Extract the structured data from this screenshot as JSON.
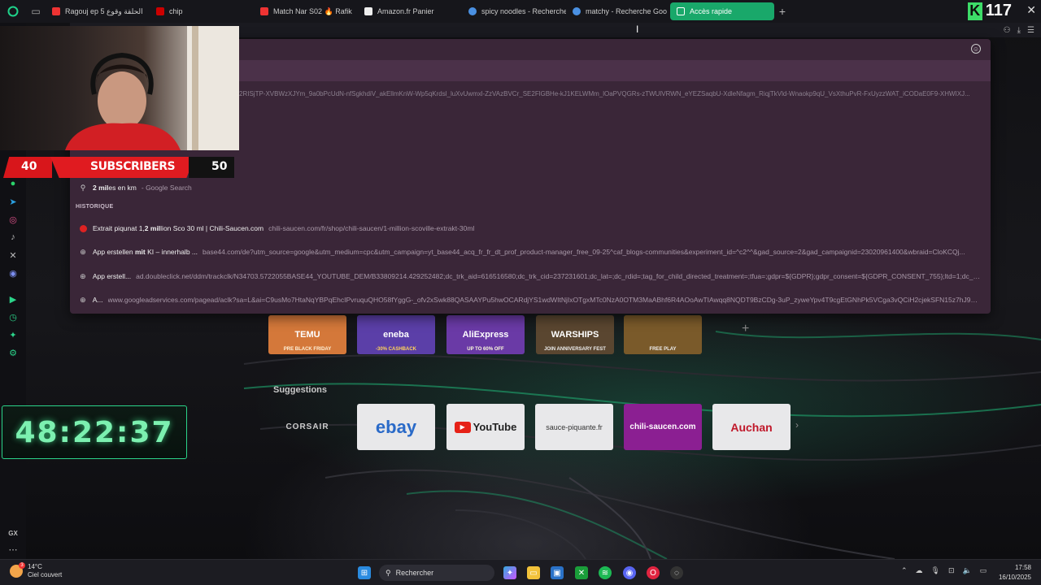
{
  "tabs": [
    {
      "label": "Ragouj ep 5 الحلقة وقوع",
      "color": "#e33"
    },
    {
      "label": "chip",
      "color": "#c00"
    },
    {
      "label": "Match Nar S02 🔥 Rafik",
      "color": "#e33"
    },
    {
      "label": "Amazon.fr Panier",
      "color": "#eee"
    },
    {
      "label": "spicy noodles - Recherche",
      "color": "#4a90e2"
    },
    {
      "label": "matchy - Recherche Goo",
      "color": "#4a90e2"
    },
    {
      "label": "Accès rapide",
      "color": "#fff"
    }
  ],
  "counter": {
    "letter": "K",
    "value": "117"
  },
  "omnibox": {
    "long_url": "2RISjTP-XVBWzXJYm_9a0bPcUdN-nfSgkhdiV_akEllmKnW-Wp5qKrdsl_luXvUwmxl-ZzVAzBVCr_SE2FlGBHe-kJ1KELWMm_lOaPVQGRs-zTWUlVRWN_eYEZSaqbU-XdleNfagm_RiqjTkVld-Wnaokp9qU_VsXthuPvR-FxUyzzWAT_iCODaE0F9-XHWIXJ...",
    "search_suggestion": {
      "bold": "2 mil",
      "rest": "es en km",
      "source": "- Google Search"
    },
    "history_label": "HISTORIQUE",
    "history": [
      {
        "title_pre": "Extrait piqunat 1,",
        "title_bold": "2 mil",
        "title_post": "lion Sco 30 ml | Chili-Saucen.com",
        "url": "chili-saucen.com/fr/shop/chili-saucen/1-million-scoville-extrakt-30ml",
        "icon": "chili-saucen-favicon"
      },
      {
        "title_pre": "App erstellen ",
        "title_bold": "mit",
        "title_post": " KI – innerhalb ...",
        "url": "base44.com/de?utm_source=google&utm_medium=cpc&utm_campaign=yt_base44_acq_fr_fr_dt_prof_product-manager_free_09-25^caf_blogs-communities&experiment_id=^c2^^&gad_source=2&gad_campaignid=23020961400&wbraid=CloKCQj...",
        "icon": "globe-icon"
      },
      {
        "title_pre": "App erstell...",
        "title_bold": "",
        "title_post": "",
        "url": "ad.doubleclick.net/ddm/trackclk/N34703.5722055BASE44_YOUTUBE_DEM/B33809214.429252482;dc_trk_aid=616516580;dc_trk_cid=237231601;dc_lat=;dc_rdid=;tag_for_child_directed_treatment=;tfua=;gdpr=${GDPR};gdpr_consent=${GDPR_CONSENT_755};ltd=1;dc_tdv=...",
        "icon": "globe-icon"
      },
      {
        "title_pre": "A...",
        "title_bold": "",
        "title_post": "",
        "url": "www.googleadservices.com/pagead/aclk?sa=L&ai=C9usMo7HtaNqYBPqEhcIPvruquQHO58fYggG-_ofv2xSwk88QASAAYPu5hwOCARdjYS1wdWItNjIxOTgxMTc0NzA0OTM3MaABhf6R4AOoAwTIAwqq8NQDT9BzCDg-3uP_zyweYpv4T9cgEtGNhPk5VCga3vQCiH2cjekSFN15z7hJ9z-mmBj...",
        "icon": "globe-icon"
      }
    ]
  },
  "speed_dial": [
    {
      "label": "TEMU",
      "sub": "PRE BLACK FRIDAY",
      "bg": "#d4783a"
    },
    {
      "label": "eneba",
      "sub": "-30%  CASHBACK",
      "bg": "#5b3fa8"
    },
    {
      "label": "AliExpress",
      "sub": "UP TO 60% OFF",
      "bg": "#6a3aa6"
    },
    {
      "label": "WARSHIPS",
      "sub": "JOIN  ANNIVERSARY FEST",
      "bg": "#5a4630"
    },
    {
      "label": "",
      "sub": "FREE  PLAY",
      "bg": "#7a5a2a"
    }
  ],
  "suggestions": {
    "title": "Suggestions",
    "items": [
      {
        "label": "CORSAIR",
        "bg": "transparent",
        "color": "#ccc"
      },
      {
        "label": "ebay",
        "bg": "#e8e8ea",
        "color": "#2a6ac8"
      },
      {
        "label": "YouTube",
        "bg": "#e8e8ea",
        "color": "#222"
      },
      {
        "label": "sauce-piquante.fr",
        "bg": "#e8e8ea",
        "color": "#333"
      },
      {
        "label": "chili-saucen.com",
        "bg": "#8b1f92",
        "color": "#fff"
      },
      {
        "label": "Auchan",
        "bg": "#e8e8ea",
        "color": "#c0182a"
      }
    ]
  },
  "overlay": {
    "sub_left": "40",
    "sub_label": "SUBSCRIBERS",
    "sub_right": "50",
    "timer": "48:22:37"
  },
  "taskbar": {
    "temp": "14°C",
    "weather": "Ciel couvert",
    "badge": "3",
    "search": "Rechercher",
    "time": "17:58",
    "date": "16/10/2025"
  },
  "sidebar": {
    "gx_label": "GX"
  }
}
